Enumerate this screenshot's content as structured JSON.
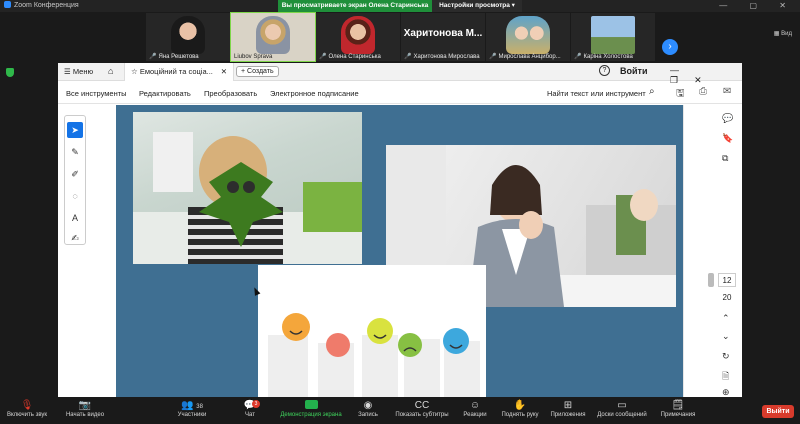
{
  "window": {
    "app_title": "Zoom Конференция"
  },
  "share_banner": {
    "message": "Вы просматриваете экран Олена Старинська",
    "options": "Настройки просмотра ▾"
  },
  "gallery": {
    "view_label": "Вид",
    "tiles": [
      {
        "name": "Яна Решетова"
      },
      {
        "name": "Liubov Sprava"
      },
      {
        "name": "Олена Старинська"
      },
      {
        "name": "Харитонова Мирослава",
        "big_name": "Харитонова М..."
      },
      {
        "name": "Мирослава Анцибор..."
      },
      {
        "name": "Каріна Холостова"
      }
    ]
  },
  "acrobat": {
    "menu_label": "Меню",
    "tab_title": "Емоційний та соціа...",
    "create_label": "Создать",
    "help_label": "?",
    "signin_label": "Войти",
    "toolbar": {
      "all_tools": "Все инструменты",
      "edit": "Редактировать",
      "convert": "Преобразовать",
      "esign": "Электронное подписание",
      "search_label": "Найти текст или инструмент"
    },
    "page_current": "12",
    "page_total": "20"
  },
  "bottombar": {
    "mic": "Включить звук",
    "video": "Начать видео",
    "participants": "Участники",
    "participants_count": "38",
    "chat": "Чат",
    "chat_badge": "3",
    "share": "Демонстрация экрана",
    "record": "Запись",
    "subtitles": "Показать субтитры",
    "reactions": "Реакции",
    "raise_hand": "Поднять руку",
    "apps": "Приложения",
    "whiteboards": "Доски сообщений",
    "notes": "Примечания",
    "leave": "Выйти"
  },
  "colors": {
    "accent": "#2d8cff",
    "share_green": "#1f8f3a",
    "leave_red": "#d83b2c",
    "slide_bg": "#3f6f92"
  }
}
